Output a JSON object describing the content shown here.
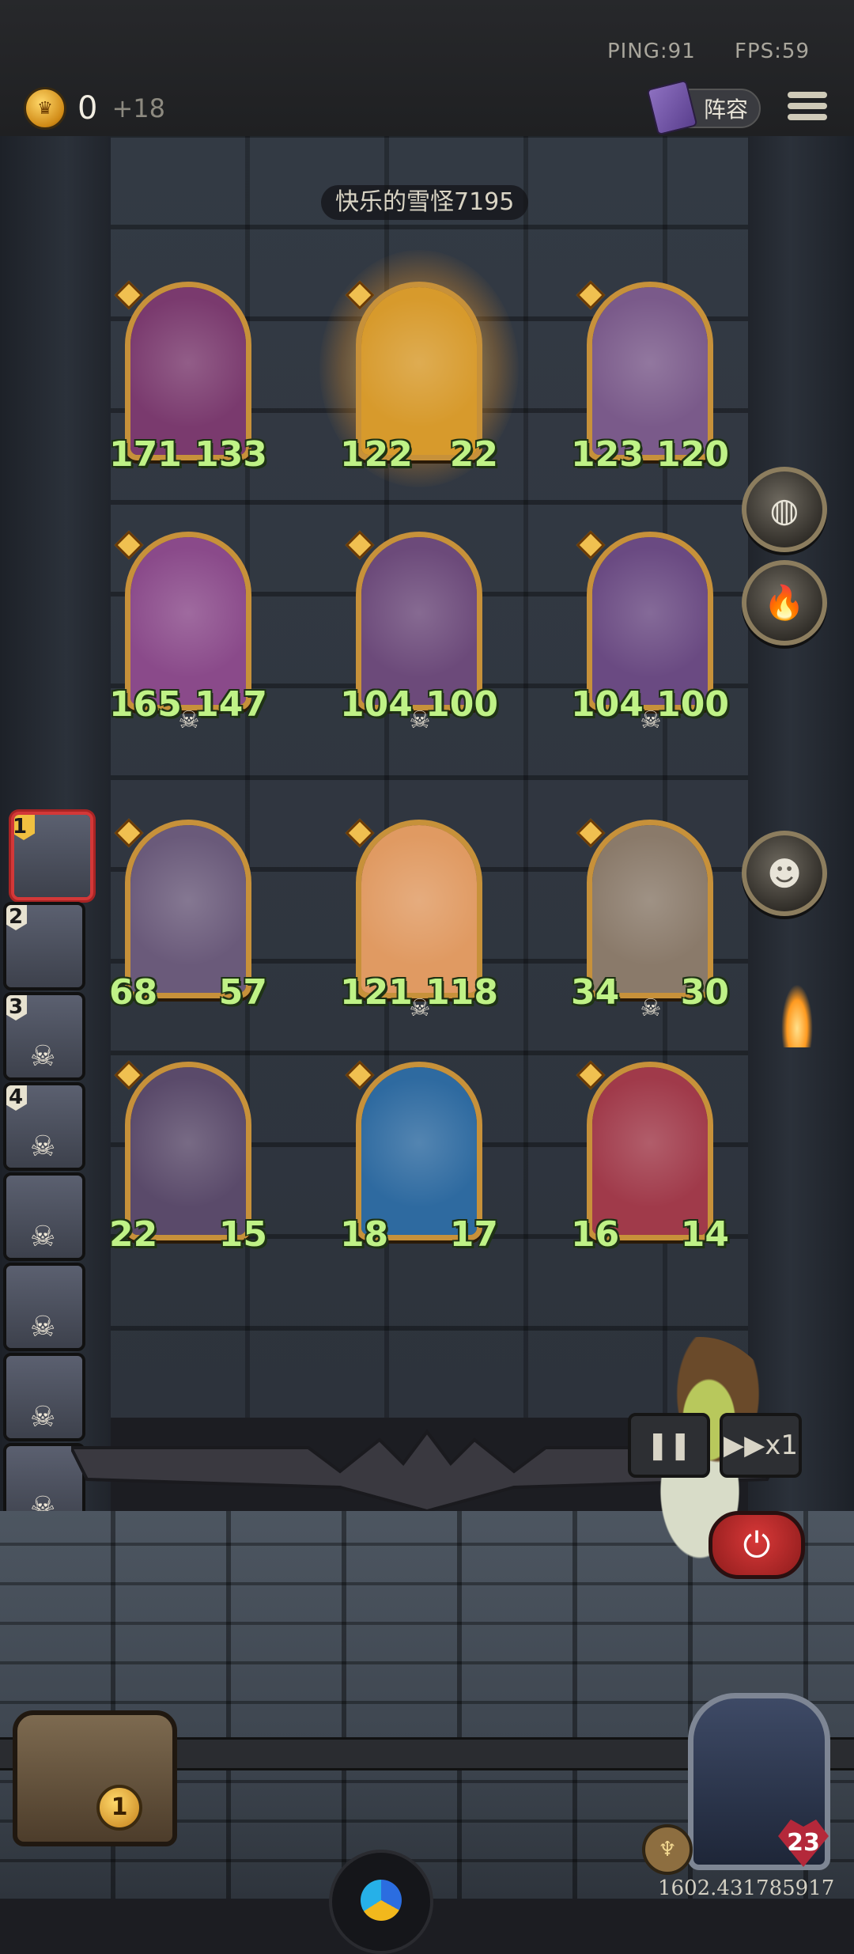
{
  "hud": {
    "ping": "PING:91",
    "fps": "FPS:59",
    "gold": "0",
    "gold_income": "+18",
    "lineup_label": "阵容"
  },
  "opponent_name": "快乐的雪怪7195",
  "board": {
    "cards": [
      {
        "atk": "171",
        "hp": "133",
        "art": "red-demon",
        "color": "#7a3a6e"
      },
      {
        "atk": "122",
        "hp": "22",
        "art": "golden-shield-minion",
        "color": "#d79a2c",
        "glow": true
      },
      {
        "atk": "123",
        "hp": "120",
        "art": "horned-beast",
        "color": "#7a5a8a"
      },
      {
        "atk": "165",
        "hp": "147",
        "art": "moon-helmet-creature",
        "color": "#8a4a8a",
        "skull": true
      },
      {
        "atk": "104",
        "hp": "100",
        "art": "hooded-rogue",
        "color": "#6c4a7a",
        "skull": true
      },
      {
        "atk": "104",
        "hp": "100",
        "art": "robot",
        "color": "#6a4a82",
        "skull": true
      },
      {
        "atk": "68",
        "hp": "57",
        "art": "dragon-head",
        "color": "#6a5a7a"
      },
      {
        "atk": "121",
        "hp": "118",
        "art": "fire-elemental",
        "color": "#e09a62",
        "skull": true
      },
      {
        "atk": "34",
        "hp": "30",
        "art": "airship",
        "color": "#8a7a6a",
        "skull": true
      },
      {
        "atk": "22",
        "hp": "15",
        "art": "skull-mage",
        "color": "#5a4a6a"
      },
      {
        "atk": "18",
        "hp": "17",
        "art": "blue-dragon",
        "color": "#2e6aa0"
      },
      {
        "atk": "16",
        "hp": "14",
        "art": "clown",
        "color": "#a03a4a"
      }
    ]
  },
  "side_items": [
    {
      "icon": "crystal-orb-icon",
      "glyph": "◍"
    },
    {
      "icon": "lighter-icon",
      "glyph": "🔥"
    },
    {
      "icon": "mask-icon",
      "glyph": "☻"
    }
  ],
  "queue": [
    {
      "rank": "1",
      "active": true,
      "skull": false
    },
    {
      "rank": "2",
      "active": false,
      "skull": false
    },
    {
      "rank": "3",
      "active": false,
      "skull": true
    },
    {
      "rank": "4",
      "active": false,
      "skull": true
    },
    {
      "rank": "",
      "active": false,
      "skull": true
    },
    {
      "rank": "",
      "active": false,
      "skull": true
    },
    {
      "rank": "",
      "active": false,
      "skull": true
    },
    {
      "rank": "",
      "active": false,
      "skull": true
    }
  ],
  "controls": {
    "pause_label": "❚❚",
    "speed_label": "▶▶x1"
  },
  "bottom": {
    "chest_count": "1",
    "hero_hp": "23",
    "coordinates": "1602.431785917"
  }
}
